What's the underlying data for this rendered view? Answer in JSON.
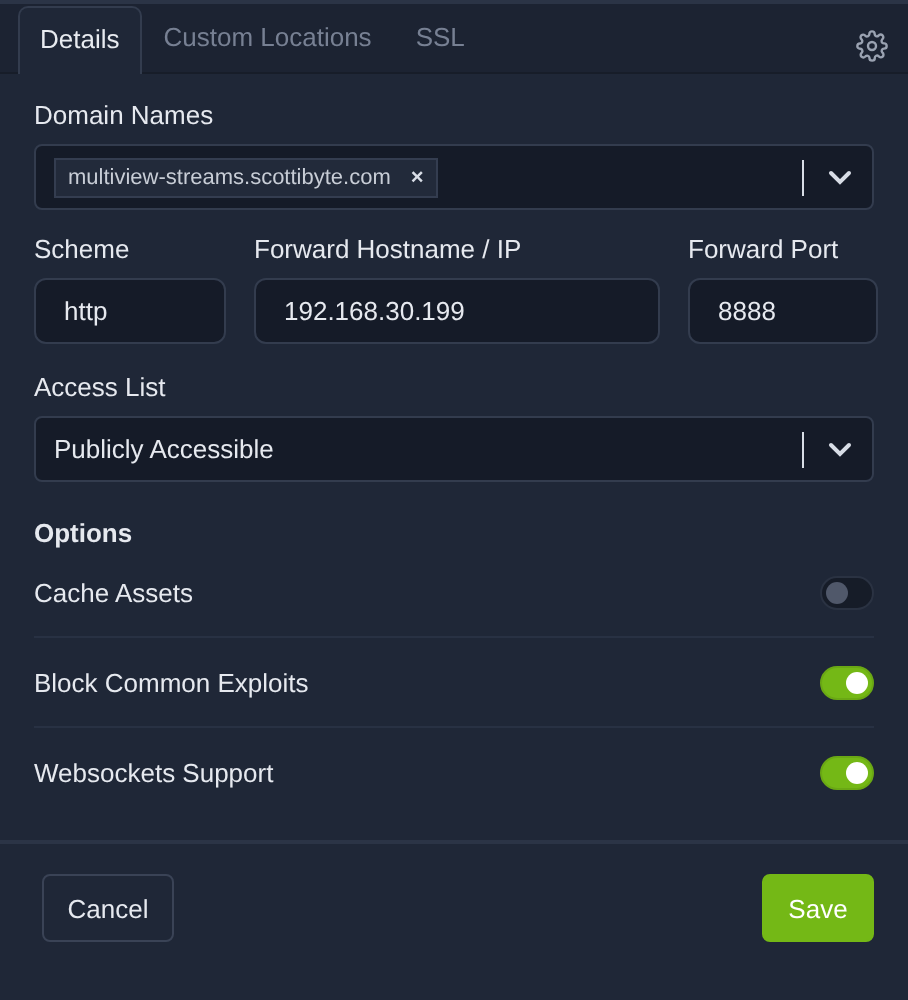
{
  "tabs": [
    {
      "label": "Details",
      "selected": true
    },
    {
      "label": "Custom Locations",
      "selected": false
    },
    {
      "label": "SSL",
      "selected": false
    }
  ],
  "domain_names": {
    "label": "Domain Names",
    "tags": [
      {
        "text": "multiview-streams.scottibyte.com",
        "remove": "×"
      }
    ]
  },
  "scheme": {
    "label": "Scheme",
    "value": "http"
  },
  "forward_hostname": {
    "label": "Forward Hostname / IP",
    "value": "192.168.30.199"
  },
  "forward_port": {
    "label": "Forward Port",
    "value": "8888"
  },
  "access_list": {
    "label": "Access List",
    "value": "Publicly Accessible"
  },
  "options": {
    "title": "Options",
    "items": [
      {
        "label": "Cache Assets",
        "on": false
      },
      {
        "label": "Block Common Exploits",
        "on": true
      },
      {
        "label": "Websockets Support",
        "on": true
      }
    ]
  },
  "buttons": {
    "cancel": "Cancel",
    "save": "Save"
  }
}
